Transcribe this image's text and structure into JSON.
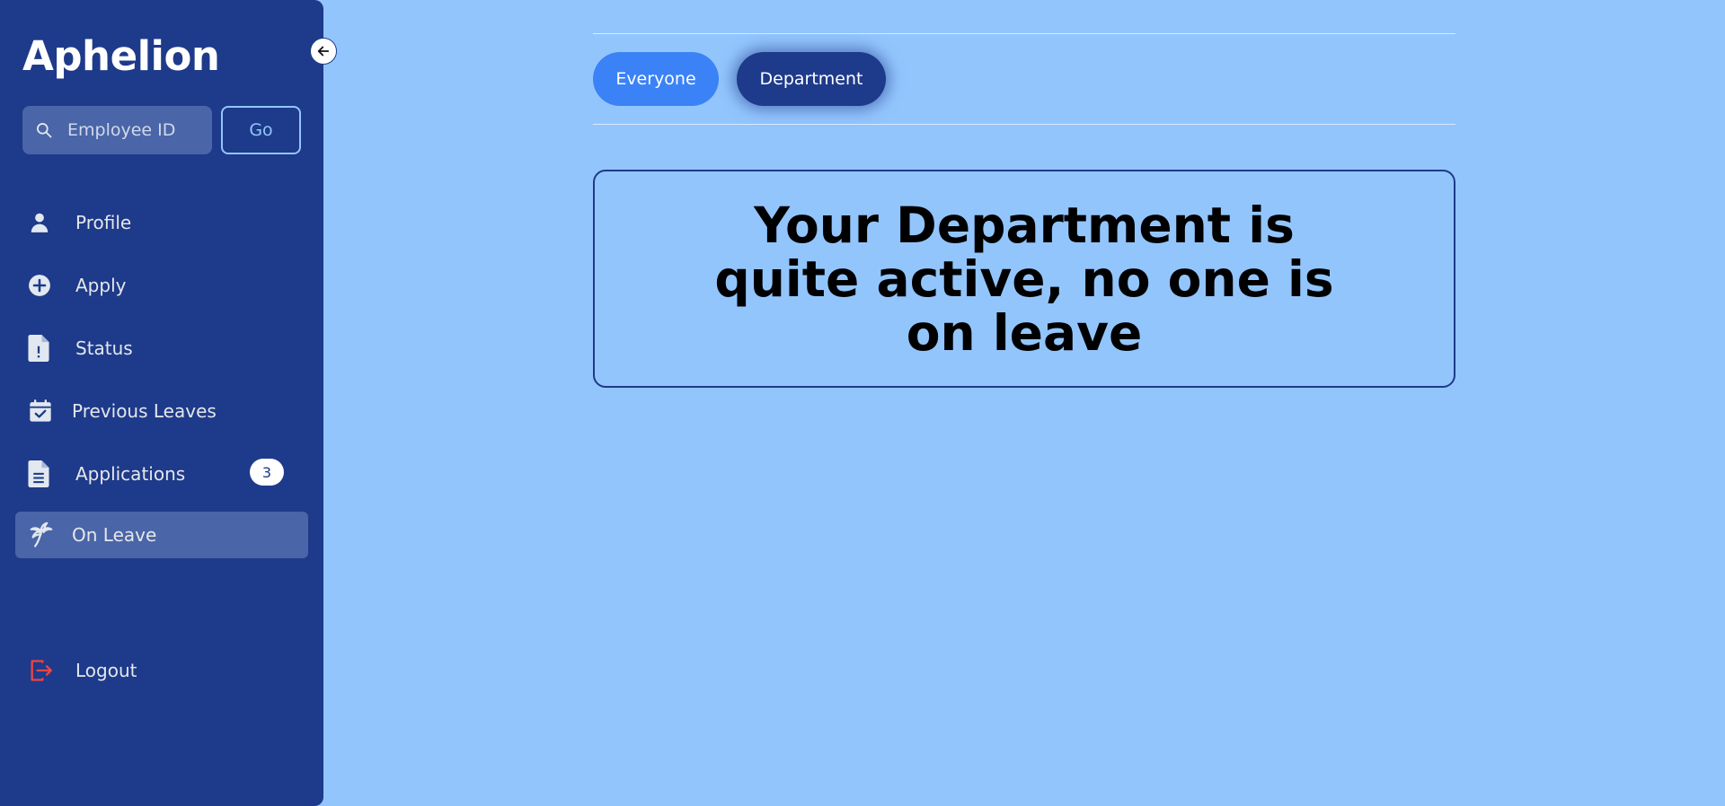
{
  "app": {
    "title": "Aphelion"
  },
  "search": {
    "placeholder": "Employee ID",
    "go_label": "Go"
  },
  "sidebar": {
    "items": [
      {
        "label": "Profile",
        "icon": "person-icon"
      },
      {
        "label": "Apply",
        "icon": "plus-circle-icon"
      },
      {
        "label": "Status",
        "icon": "file-alert-icon"
      },
      {
        "label": "Previous Leaves",
        "icon": "calendar-check-icon"
      },
      {
        "label": "Applications",
        "icon": "document-icon",
        "badge": "3"
      },
      {
        "label": "On Leave",
        "icon": "palm-tree-icon",
        "active": true
      }
    ],
    "logout_label": "Logout"
  },
  "tabs": [
    {
      "label": "Everyone",
      "active": false
    },
    {
      "label": "Department",
      "active": true
    }
  ],
  "message": "Your Department is quite active, no one is on leave",
  "colors": {
    "sidebar_bg": "#1e3a8a",
    "page_bg": "#93c5fd",
    "accent": "#3b82f6",
    "logout": "#ef4444"
  }
}
